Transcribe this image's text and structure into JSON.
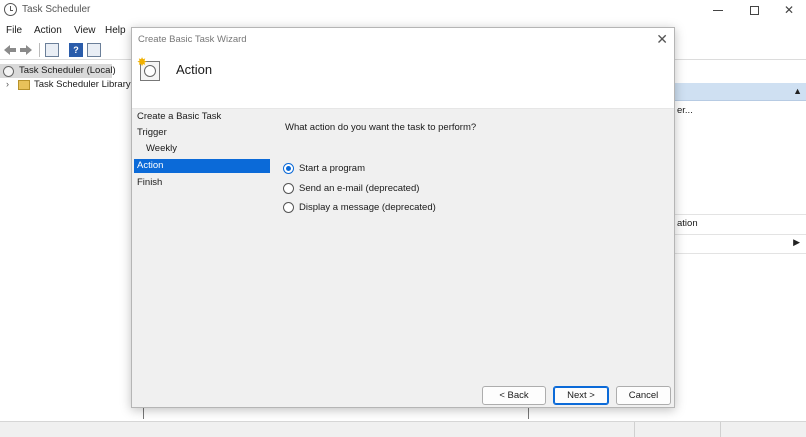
{
  "window": {
    "title": "Task Scheduler"
  },
  "menu": [
    "File",
    "Action",
    "View",
    "Help"
  ],
  "toolbar": {
    "help_glyph": "?"
  },
  "tree": {
    "items": [
      {
        "label": "Task Scheduler (Local)",
        "selected": true
      },
      {
        "label": "Task Scheduler Library",
        "selected": false
      }
    ]
  },
  "actions_pane": {
    "item_1": "er...",
    "item_2": "ation"
  },
  "dialog": {
    "title": "Create Basic Task Wizard",
    "header": "Action",
    "steps": [
      {
        "label": "Create a Basic Task",
        "active": false,
        "sub": false
      },
      {
        "label": "Trigger",
        "active": false,
        "sub": false
      },
      {
        "label": "Weekly",
        "active": false,
        "sub": true
      },
      {
        "label": "Action",
        "active": true,
        "sub": false
      },
      {
        "label": "Finish",
        "active": false,
        "sub": false
      }
    ],
    "question": "What action do you want the task to perform?",
    "options": [
      {
        "label": "Start a program",
        "checked": true
      },
      {
        "label": "Send an e-mail (deprecated)",
        "checked": false
      },
      {
        "label": "Display a message (deprecated)",
        "checked": false
      }
    ],
    "buttons": {
      "back": "< Back",
      "next": "Next >",
      "cancel": "Cancel"
    }
  },
  "colors": {
    "accent": "#0b6ad8",
    "selection_header": "#cfe0f2"
  }
}
